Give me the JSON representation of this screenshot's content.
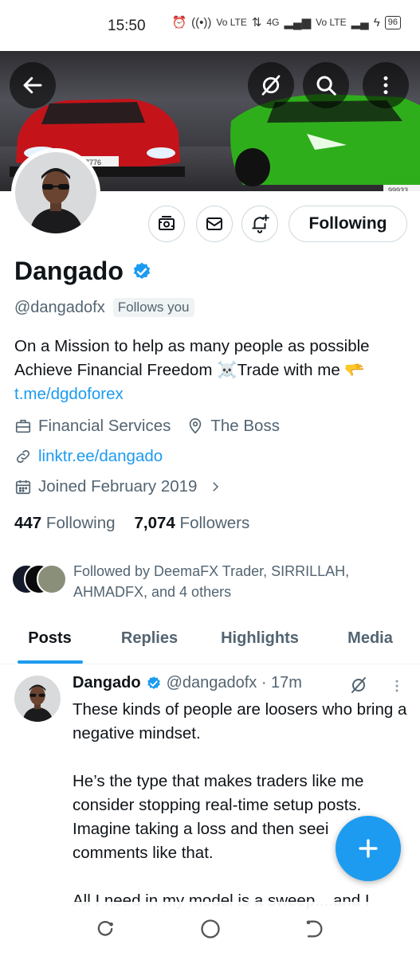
{
  "status_bar": {
    "time": "15:50",
    "network1": "Vo LTE",
    "network2": "4G",
    "network3": "Vo LTE",
    "battery": "96"
  },
  "profile": {
    "display_name": "Dangado",
    "handle": "@dangadofx",
    "follows_you": "Follows you",
    "bio_text": "On a Mission to help as many people as possible Achieve Financial Freedom ☠️Trade with me 🫳",
    "bio_link": "t.me/dgdoforex",
    "category": "Financial Services",
    "location": "The Boss",
    "website": "linktr.ee/dangado",
    "joined": "Joined February 2019",
    "following_count": "447",
    "following_label": "Following",
    "followers_count": "7,074",
    "followers_label": "Followers",
    "followed_by": "Followed by DeemaFX Trader, SIRRILLAH, AHMADFX, and 4 others",
    "follow_button": "Following"
  },
  "banner": {
    "plate_left": "77776",
    "plate_right": "99933"
  },
  "tabs": [
    {
      "label": "Posts",
      "active": true
    },
    {
      "label": "Replies",
      "active": false
    },
    {
      "label": "Highlights",
      "active": false
    },
    {
      "label": "Media",
      "active": false
    }
  ],
  "post": {
    "author": "Dangado",
    "handle_time": "@dangadofx · 17m",
    "text": "These kinds of people are loosers who bring a negative mindset.\n\nHe’s the type that makes traders like me consider stopping real-time setup posts. Imagine taking a loss and then seei comments like that.\n\nAll I need in my model is a sweep....and I"
  },
  "icons": {
    "back": "back-arrow-icon",
    "grok": "grok-icon",
    "search": "search-icon",
    "more": "more-vertical-icon",
    "subscribe": "subscription-icon",
    "message": "mail-icon",
    "notify": "bell-plus-icon",
    "briefcase": "briefcase-icon",
    "location": "location-pin-icon",
    "link": "link-icon",
    "calendar": "calendar-icon",
    "verified": "verified-badge-icon",
    "compose": "plus-icon"
  },
  "colors": {
    "accent": "#1d9bf0",
    "text": "#0f1419",
    "secondary": "#536471"
  }
}
